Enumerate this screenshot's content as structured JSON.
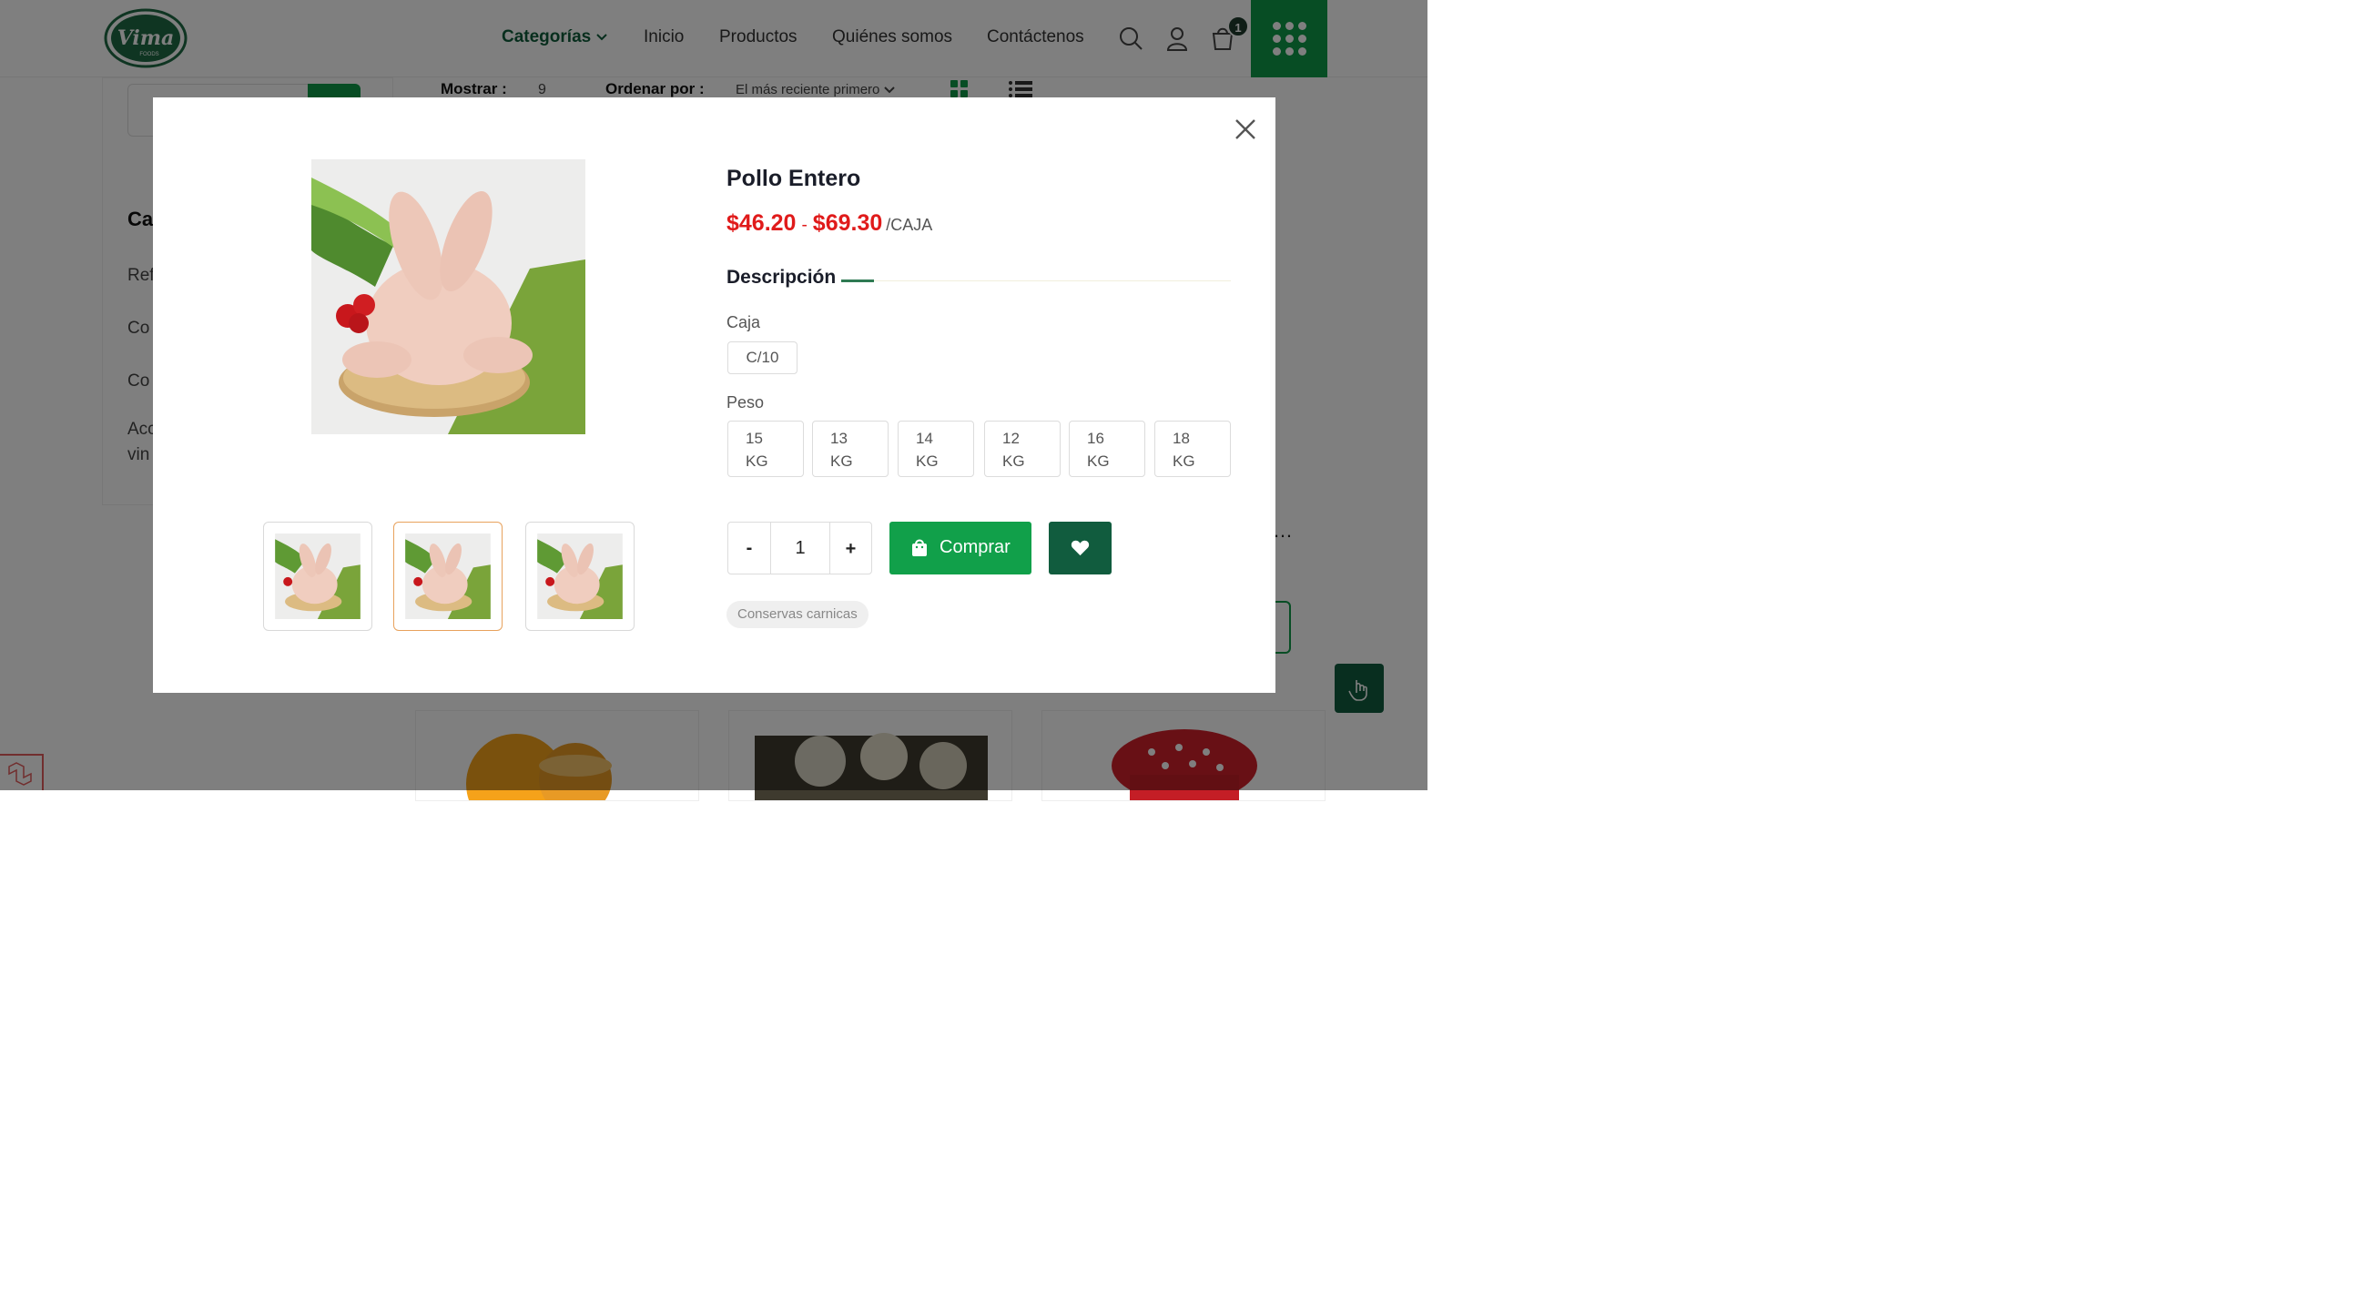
{
  "header": {
    "logo_text": "Vima",
    "logo_subtext": "FOODS",
    "nav": {
      "categories": "Categorías",
      "home": "Inicio",
      "products": "Productos",
      "about": "Quiénes somos",
      "contact": "Contáctenos"
    },
    "cart_count": "1"
  },
  "sidebar": {
    "title": "Ca",
    "items": [
      "Ref",
      "Co",
      "Co",
      "Acc",
      "vin"
    ]
  },
  "toolbar": {
    "show_label": "Mostrar :",
    "show_value": "9",
    "sort_label": "Ordenar por :",
    "sort_value": "El más reciente primero"
  },
  "modal": {
    "product_title": "Pollo Entero",
    "price_min": "$46.20",
    "price_separator": "-",
    "price_max": "$69.30",
    "price_unit": "/CAJA",
    "description_heading": "Descripción",
    "box_label": "Caja",
    "box_options": [
      "C/10"
    ],
    "weight_label": "Peso",
    "weight_options": [
      {
        "value": "15",
        "unit": "KG"
      },
      {
        "value": "13",
        "unit": "KG"
      },
      {
        "value": "14",
        "unit": "KG"
      },
      {
        "value": "12",
        "unit": "KG"
      },
      {
        "value": "16",
        "unit": "KG"
      },
      {
        "value": "18",
        "unit": "KG"
      }
    ],
    "quantity": "1",
    "qty_minus": "-",
    "qty_plus": "+",
    "buy_label": "Comprar",
    "tag": "Conservas carnicas",
    "thumbnails_count": 3,
    "selected_thumbnail": 2
  },
  "colors": {
    "brand_green": "#0f9a48",
    "dark_green": "#115c3e",
    "price_red": "#e01b1b",
    "selected_thumb_border": "#e8a25d"
  }
}
